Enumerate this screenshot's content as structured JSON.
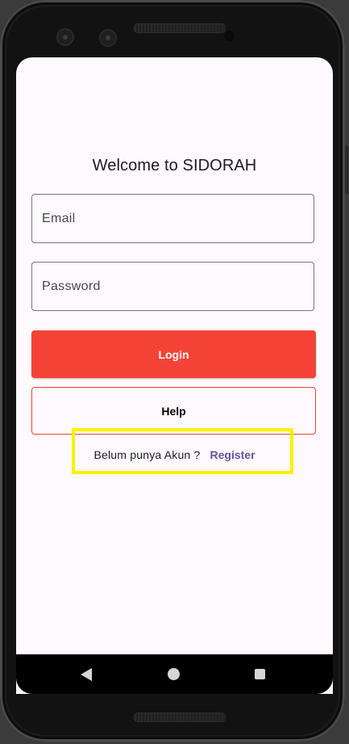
{
  "screen": {
    "title": "Welcome to SIDORAH"
  },
  "form": {
    "email": {
      "placeholder": "Email",
      "value": ""
    },
    "password": {
      "placeholder": "Password",
      "value": ""
    },
    "login_label": "Login",
    "help_label": "Help"
  },
  "register": {
    "question": "Belum punya Akun ?",
    "link": "Register"
  },
  "navbar": {
    "back": "back-icon",
    "home": "home-icon",
    "recents": "recents-icon"
  },
  "colors": {
    "primary": "#f44336",
    "link": "#6750a4",
    "background": "#fdf9fd",
    "highlight": "#fff200"
  }
}
